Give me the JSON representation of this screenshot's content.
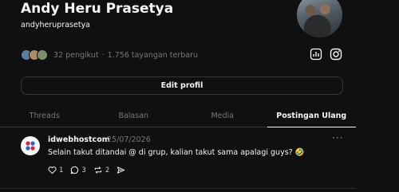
{
  "profile": {
    "name": "Andy Heru Prasetya",
    "handle": "andyheruprasetya",
    "followers_text": "32 pengikut",
    "views_text": "1.756 tayangan terbaru",
    "separator": "·"
  },
  "edit_profile_label": "Edit profil",
  "tabs": [
    {
      "label": "Threads"
    },
    {
      "label": "Balasan"
    },
    {
      "label": "Media"
    },
    {
      "label": "Postingan Ulang"
    }
  ],
  "post": {
    "username": "idwebhostcom",
    "date": "25/07/2026",
    "more": "···",
    "text": "Selain takut ditandai @ di grup, kalian takut sama apalagi guys? 🤣",
    "likes": "1",
    "replies": "3",
    "reposts": "2"
  },
  "colors": {
    "background": "#101010",
    "text": "#f3f5f7",
    "muted": "#777777",
    "border": "#333638"
  }
}
